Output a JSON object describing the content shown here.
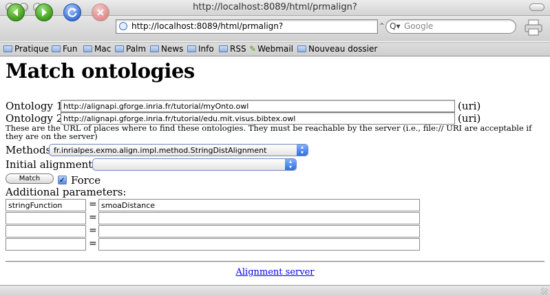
{
  "window": {
    "title": "http://localhost:8089/html/prmalign?"
  },
  "toolbar": {
    "back_icon": "back-arrow-icon",
    "forward_icon": "forward-arrow-icon",
    "reload_icon": "reload-icon",
    "stop_icon": "stop-icon",
    "url": "http://localhost:8089/html/prmalign?",
    "search_placeholder": "Google",
    "print_icon": "printer-icon"
  },
  "bookmarks": [
    {
      "label": "Pratique",
      "icon": "folder-icon"
    },
    {
      "label": "Fun",
      "icon": "folder-icon"
    },
    {
      "label": "Mac",
      "icon": "folder-icon"
    },
    {
      "label": "Palm",
      "icon": "folder-icon"
    },
    {
      "label": "News",
      "icon": "folder-icon"
    },
    {
      "label": "Info",
      "icon": "folder-icon"
    },
    {
      "label": "RSS",
      "icon": "folder-icon"
    },
    {
      "label": "Webmail",
      "icon": "pen-icon"
    },
    {
      "label": "Nouveau dossier",
      "icon": "folder-icon"
    }
  ],
  "page": {
    "heading": "Match ontologies",
    "onto1": {
      "label": "Ontology 1:",
      "value": "http://alignapi.gforge.inria.fr/tutorial/myOnto.owl",
      "suffix": "(uri)"
    },
    "onto2": {
      "label": "Ontology 2:",
      "value": "http://alignapi.gforge.inria.fr/tutorial/edu.mit.visus.bibtex.owl",
      "suffix": "(uri)"
    },
    "note": "These are the URL of places where to find these ontologies. They must be reachable by the server (i.e., file:// URI are acceptable if they are on the server)",
    "methods": {
      "label": "Methods:",
      "value": "fr.inrialpes.exmo.align.impl.method.StringDistAlignment"
    },
    "initial": {
      "label": "Initial alignment id:",
      "value": ""
    },
    "match_button": "Match",
    "force": {
      "label": "Force",
      "checked": true
    },
    "params_label": "Additional parameters:",
    "params": [
      {
        "name": "stringFunction",
        "eq": "=",
        "value": "smoaDistance"
      },
      {
        "name": "",
        "eq": "=",
        "value": ""
      },
      {
        "name": "",
        "eq": "=",
        "value": ""
      },
      {
        "name": "",
        "eq": "=",
        "value": ""
      }
    ],
    "footer_link": "Alignment server"
  },
  "colors": {
    "link": "#0000ee",
    "accent": "#3d73d6"
  }
}
